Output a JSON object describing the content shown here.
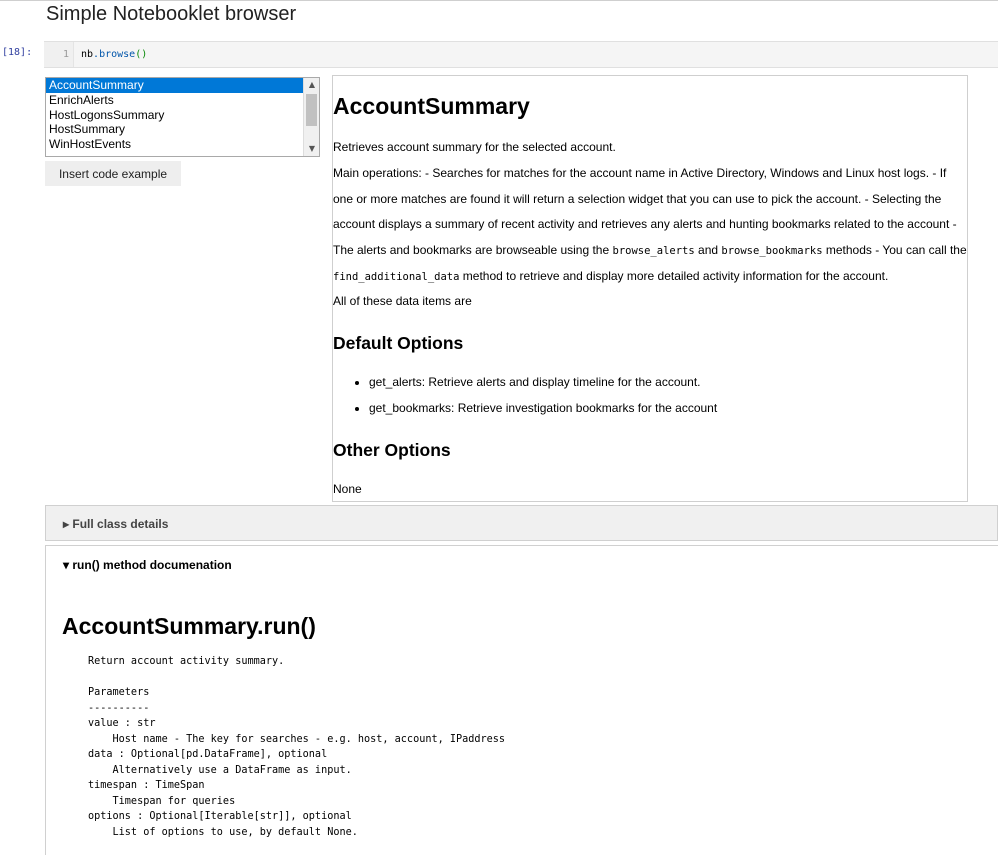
{
  "notebook": {
    "title": "Simple Notebooklet browser",
    "cell_prompt": "[18]:",
    "line_number": "1",
    "code_object": "nb",
    "code_method": ".browse",
    "code_parens": "()"
  },
  "browser": {
    "notebooklets": [
      "AccountSummary",
      "EnrichAlerts",
      "HostLogonsSummary",
      "HostSummary",
      "WinHostEvents"
    ],
    "selected": "AccountSummary",
    "insert_button_label": "Insert code example"
  },
  "doc": {
    "title": "AccountSummary",
    "description": "Retrieves account summary for the selected account.",
    "main_ops": {
      "t1": "Main operations: - Searches for matches for the account name in Active Directory, Windows and Linux host logs. - If one or more matches are found it will return a selection widget that you can use to pick the account. - Selecting the account displays a summary of recent activity and retrieves any alerts and hunting bookmarks related to the account - The alerts and bookmarks are browseable using the ",
      "c1": "browse_alerts",
      "t2": " and ",
      "c2": "browse_bookmarks",
      "t3": " methods - You can call the ",
      "c3": "find_additional_data",
      "t4": " method to retrieve and display more detailed activity information for the account."
    },
    "all_items": "All of these data items are",
    "default_options_heading": "Default Options",
    "default_options": [
      "get_alerts: Retrieve alerts and display timeline for the account.",
      "get_bookmarks: Retrieve investigation bookmarks for the account"
    ],
    "other_options_heading": "Other Options",
    "other_options_value": "None"
  },
  "full_class_details_label": "Full class details",
  "run_doc": {
    "label": "run() method documenation",
    "title": "AccountSummary.run()",
    "lines": [
      "Return account activity summary.",
      "",
      "Parameters",
      "----------",
      "value : str",
      "    Host name - The key for searches - e.g. host, account, IPaddress",
      "data : Optional[pd.DataFrame], optional",
      "    Alternatively use a DataFrame as input.",
      "timespan : TimeSpan",
      "    Timespan for queries",
      "options : Optional[Iterable[str]], optional",
      "    List of options to use, by default None."
    ]
  }
}
